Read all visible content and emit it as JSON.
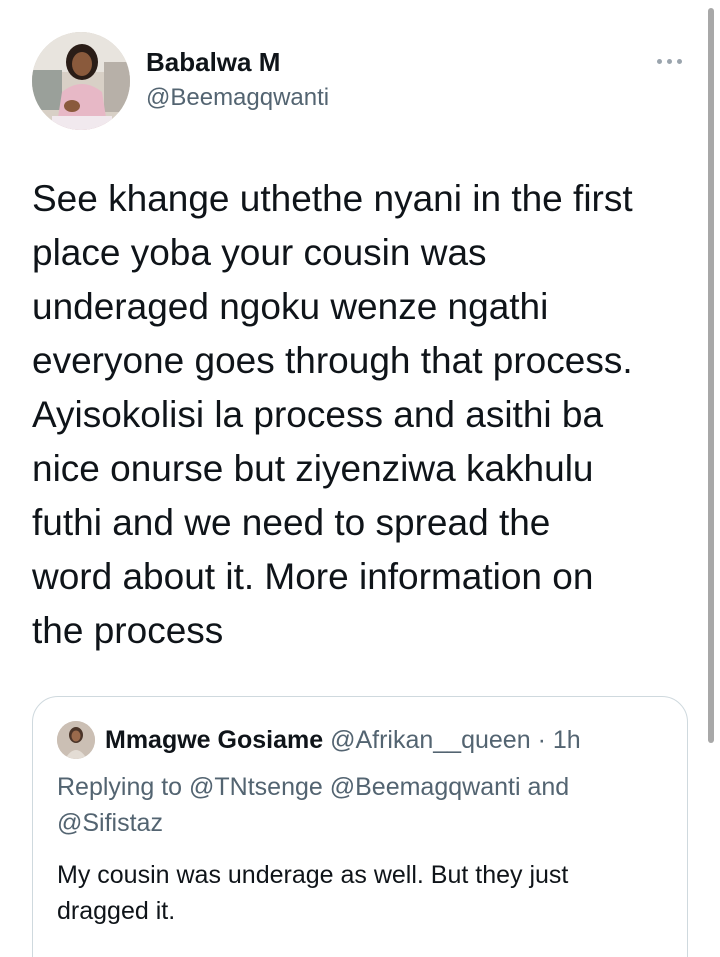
{
  "tweet": {
    "author": {
      "name": "Babalwa M",
      "handle": "@Beemagqwanti"
    },
    "text_lines": [
      "See khange uthethe nyani in the first",
      "place yoba your cousin was",
      "underaged ngoku wenze ngathi",
      "everyone goes through that process.",
      "Ayisokolisi la process and asithi ba",
      "nice onurse but ziyenziwa kakhulu",
      "futhi and we need to spread the",
      "word about it. More information on",
      "the process"
    ],
    "more_icon": "more-horizontal-icon"
  },
  "quoted_tweet": {
    "author_name": "Mmagwe Gosiame",
    "author_handle": "@Afrikan__queen",
    "separator": "·",
    "time": "1h",
    "replying_prefix": "Replying to",
    "replying_mentions": [
      "@TNtsenge",
      "@Beemagqwanti"
    ],
    "replying_and": "and",
    "replying_last": "@Sifistaz",
    "text_lines": [
      "My cousin was underage as well. But they just",
      "dragged it."
    ]
  },
  "colors": {
    "text_primary": "#0f1419",
    "text_secondary": "#536471",
    "border": "#cfd9de"
  }
}
